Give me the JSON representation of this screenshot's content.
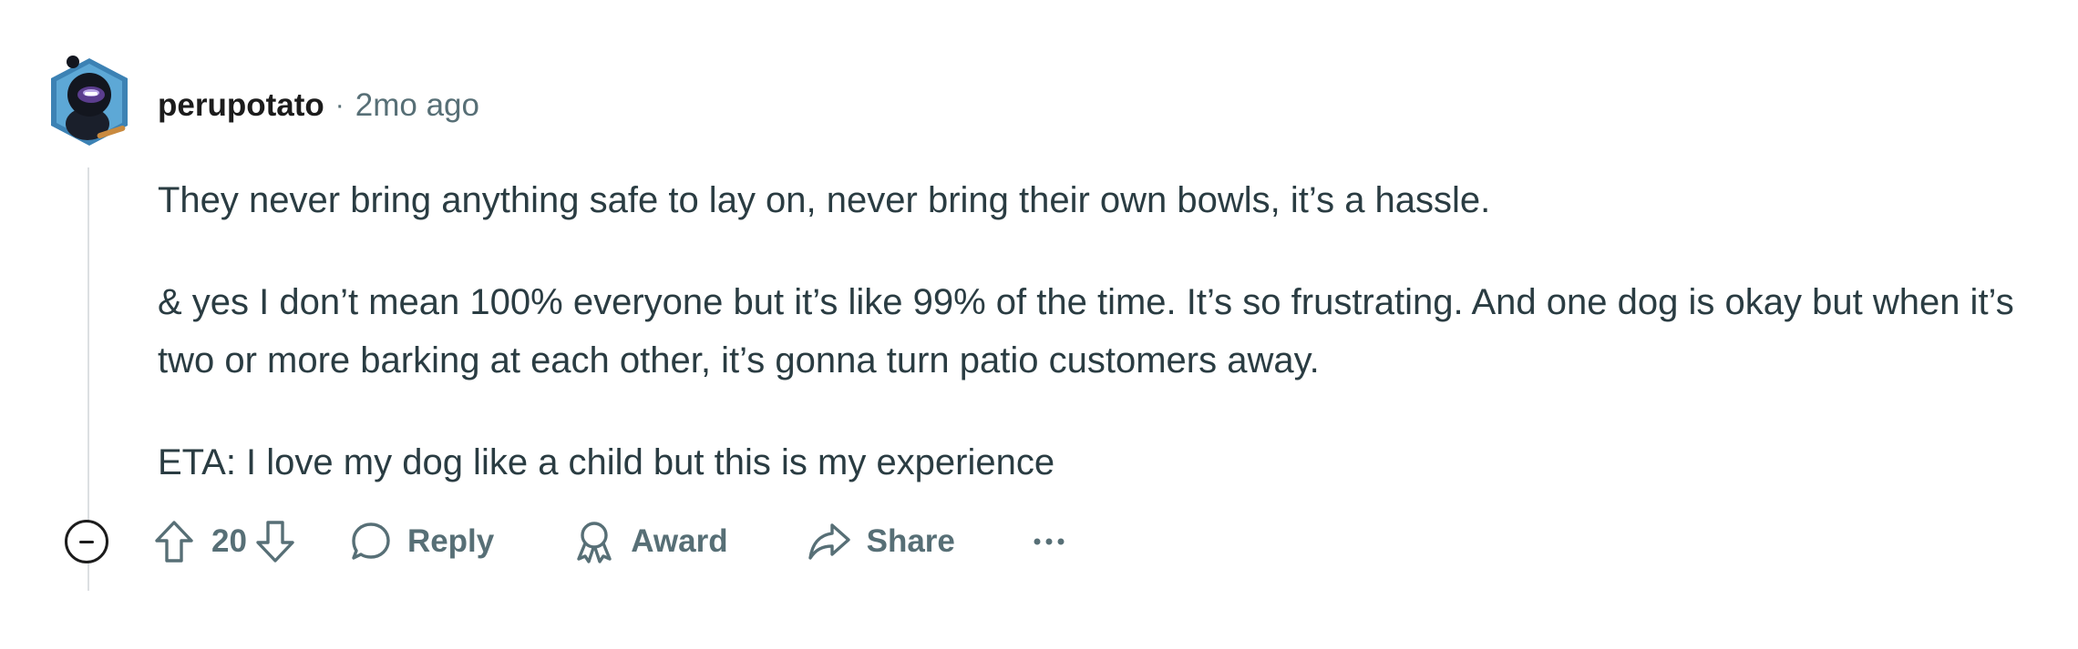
{
  "comment": {
    "author": "perupotato",
    "separator": "·",
    "age": "2mo ago",
    "paragraphs": [
      "They never bring anything safe to lay on, never bring their own bowls, it’s a hassle.",
      "& yes I don’t mean 100% everyone but it’s like 99% of the time. It’s so frustrating. And one dog is okay but when it’s two or more barking at each other, it’s gonna turn patio customers away.",
      "ETA: I love my dog like a child but this is my experience"
    ],
    "actions": {
      "vote_count": "20",
      "reply_label": "Reply",
      "award_label": "Award",
      "share_label": "Share"
    }
  },
  "icons": {
    "collapse": "minus-circle-icon",
    "upvote": "arrow-up-icon",
    "downvote": "arrow-down-icon",
    "reply": "speech-bubble-icon",
    "award": "award-ribbon-icon",
    "share": "share-arrow-icon",
    "more": "ellipsis-icon"
  },
  "colors": {
    "text": "#2a3c42",
    "meta": "#576f76",
    "username": "#1c1c1c",
    "thread_line": "#dcdfe2",
    "avatar_bg": "#3c82b4"
  }
}
